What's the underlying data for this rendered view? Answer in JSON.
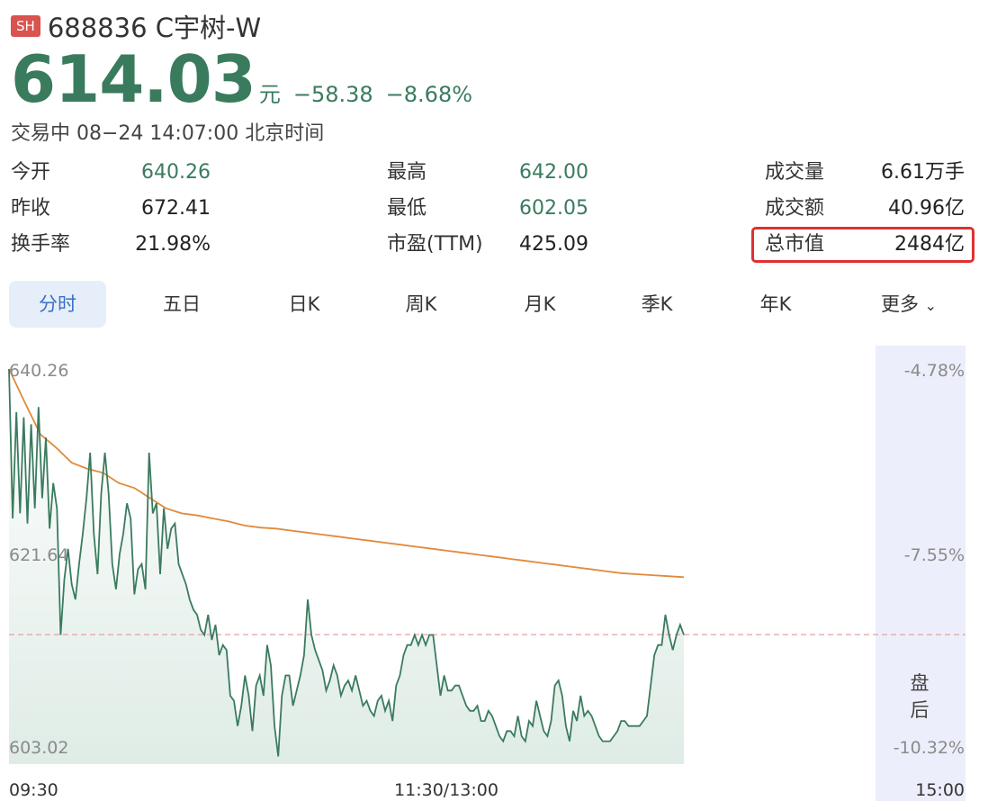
{
  "header": {
    "exchange": "SH",
    "title": "688836 C宇树-W"
  },
  "quote": {
    "price": "614.03",
    "unit": "元",
    "change": "−58.38",
    "change_pct": "−8.68%",
    "status": "交易中 08−24 14:07:00 北京时间"
  },
  "stats": {
    "open_label": "今开",
    "open": "640.26",
    "prev_close_label": "昨收",
    "prev_close": "672.41",
    "turnover_label": "换手率",
    "turnover": "21.98%",
    "high_label": "最高",
    "high": "642.00",
    "low_label": "最低",
    "low": "602.05",
    "pe_label": "市盈(TTM)",
    "pe": "425.09",
    "volume_label": "成交量",
    "volume": "6.61万手",
    "amount_label": "成交额",
    "amount": "40.96亿",
    "mktcap_label": "总市值",
    "mktcap": "2484亿"
  },
  "tabs": [
    "分时",
    "五日",
    "日K",
    "周K",
    "月K",
    "季K",
    "年K",
    "更多"
  ],
  "after_hours_label": "盘\n后",
  "colors": {
    "up_down_green": "#3a7b5e",
    "avg_line": "#e08a3c",
    "highlight": "#e03030"
  },
  "chart_data": {
    "type": "line",
    "y_left_ticks": [
      "640.26",
      "621.64",
      "603.02"
    ],
    "y_right_ticks": [
      "-4.78%",
      "-7.55%",
      "-10.32%"
    ],
    "x_ticks": [
      "09:30",
      "11:30/13:00",
      "15:00"
    ],
    "ylim": [
      603.02,
      640.26
    ],
    "reference_line": 614.03,
    "series": [
      {
        "name": "",
        "values": [
          640.26,
          625.5,
          636.0,
          626.0,
          635.5,
          625.0,
          634.8,
          626.5,
          636.5,
          627.5,
          633.5,
          624.5,
          629.0,
          626.5,
          614.0,
          619.5,
          622.5,
          619.0,
          617.5,
          621.0,
          624.0,
          627.5,
          632.0,
          624.0,
          620.0,
          628.0,
          632.0,
          628.0,
          621.0,
          618.5,
          622.0,
          624.0,
          627.0,
          625.5,
          618.0,
          620.5,
          621.0,
          618.5,
          632.0,
          626.0,
          627.0,
          620.0,
          626.5,
          622.5,
          624.5,
          625.0,
          621.0,
          620.0,
          619.0,
          617.5,
          616.5,
          616.0,
          614.5,
          614.0,
          616.0,
          613.5,
          615.0,
          612.0,
          613.0,
          612.5,
          608.0,
          607.5,
          605.0,
          607.0,
          610.0,
          608.0,
          604.5,
          609.0,
          610.0,
          608.0,
          613.0,
          611.0,
          605.0,
          602.0,
          608.0,
          610.0,
          610.0,
          607.0,
          608.5,
          610.0,
          612.0,
          617.5,
          614.0,
          612.5,
          611.5,
          610.5,
          608.5,
          609.5,
          611.0,
          610.0,
          608.0,
          609.0,
          609.5,
          608.5,
          610.0,
          608.5,
          607.0,
          607.5,
          606.5,
          606.0,
          607.5,
          608.0,
          606.5,
          607.5,
          605.5,
          609.0,
          610.0,
          612.0,
          613.0,
          613.0,
          614.0,
          613.0,
          614.0,
          613.0,
          614.0,
          614.0,
          611.0,
          608.0,
          610.0,
          608.5,
          608.5,
          609.0,
          609.0,
          608.0,
          607.0,
          606.5,
          606.5,
          607.0,
          605.5,
          605.5,
          606.5,
          606.0,
          605.0,
          604.0,
          603.5,
          604.5,
          604.5,
          604.0,
          606.0,
          604.0,
          603.5,
          605.5,
          605.0,
          607.5,
          606.0,
          604.5,
          604.0,
          605.5,
          609.0,
          609.5,
          608.0,
          605.0,
          603.5,
          606.5,
          605.5,
          608.0,
          606.0,
          606.5,
          606.0,
          605.0,
          604.0,
          603.5,
          603.5,
          603.5,
          604.0,
          604.5,
          605.5,
          605.5,
          605.0,
          605.0,
          605.0,
          605.0,
          605.5,
          606.0,
          609.0,
          612.0,
          613.0,
          613.0,
          616.0,
          614.0,
          612.5,
          614.0,
          615.0,
          614.0
        ]
      },
      {
        "name": "",
        "values": [
          640.26,
          637.0,
          633.8,
          632.5,
          631.0,
          630.4,
          630.0,
          629.0,
          628.5,
          627.5,
          626.5,
          626.0,
          625.8,
          625.5,
          625.2,
          624.8,
          624.6,
          624.5,
          624.3,
          624.1,
          623.9,
          623.7,
          623.5,
          623.3,
          623.1,
          622.9,
          622.7,
          622.5,
          622.3,
          622.1,
          621.9,
          621.7,
          621.5,
          621.3,
          621.1,
          620.9,
          620.7,
          620.5,
          620.3,
          620.1,
          620.0,
          619.9,
          619.8,
          619.7
        ]
      }
    ]
  }
}
